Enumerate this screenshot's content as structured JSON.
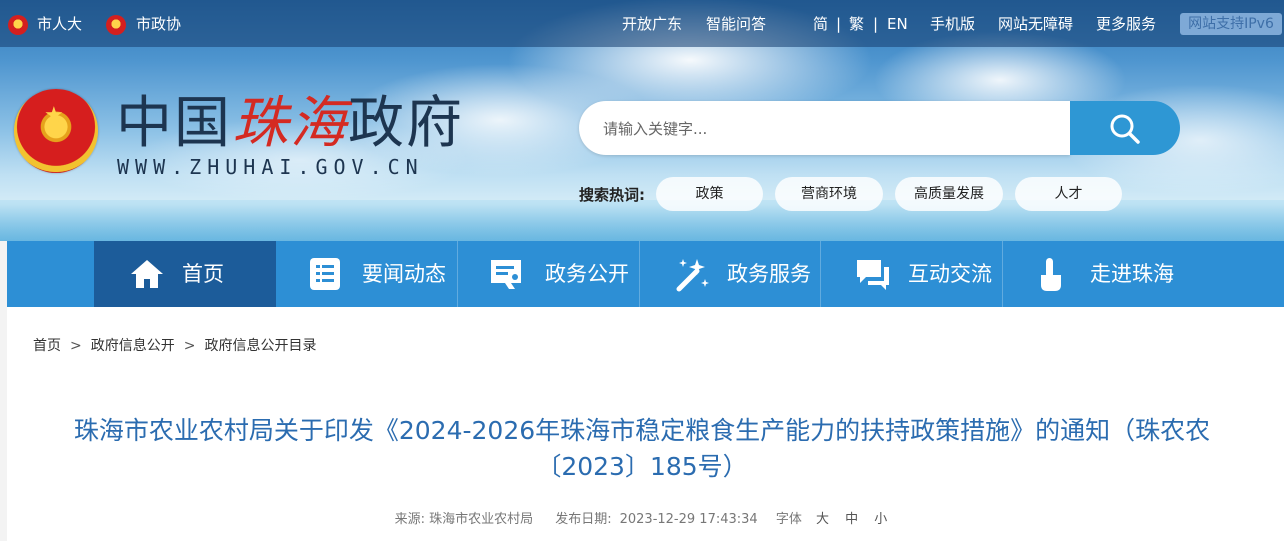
{
  "topbar": {
    "left_links": [
      {
        "label": "市人大"
      },
      {
        "label": "市政协"
      }
    ],
    "right_links": [
      {
        "label": "开放广东"
      },
      {
        "label": "智能问答"
      },
      {
        "label": "简"
      },
      {
        "label": "繁"
      },
      {
        "label": "EN"
      },
      {
        "label": "手机版"
      },
      {
        "label": "网站无障碍"
      },
      {
        "label": "更多服务"
      }
    ],
    "separator": "|",
    "ipv6_badge": "网站支持IPv6"
  },
  "logo": {
    "title_part1": "中国",
    "title_part2": "珠海",
    "title_part3": "政府",
    "url": "WWW.ZHUHAI.GOV.CN"
  },
  "search": {
    "placeholder": "请输入关键字...",
    "hot_label": "搜索热词:",
    "hot_words": [
      "政策",
      "营商环境",
      "高质量发展",
      "人才"
    ]
  },
  "nav": {
    "items": [
      {
        "label": "首页",
        "icon": "home-icon",
        "active": true
      },
      {
        "label": "要闻动态",
        "icon": "news-list-icon"
      },
      {
        "label": "政务公开",
        "icon": "document-icon"
      },
      {
        "label": "政务服务",
        "icon": "magic-wand-icon"
      },
      {
        "label": "互动交流",
        "icon": "chat-icon"
      },
      {
        "label": "走进珠海",
        "icon": "pointer-hand-icon"
      }
    ]
  },
  "breadcrumb": {
    "items": [
      "首页",
      "政府信息公开",
      "政府信息公开目录"
    ],
    "separator": ">"
  },
  "article": {
    "title": "珠海市农业农村局关于印发《2024-2026年珠海市稳定粮食生产能力的扶持政策措施》的通知（珠农农〔2023〕185号）",
    "source_label": "来源:",
    "source_value": "珠海市农业农村局",
    "date_label": "发布日期:",
    "date_value": "2023-12-29 17:43:34",
    "font_label": "字体",
    "font_sizes": [
      "大",
      "中",
      "小"
    ]
  },
  "colors": {
    "nav_bg": "#2d8fd5",
    "nav_active": "#1c5c9a",
    "title": "#2b6cb0",
    "search_button": "#2e97d4"
  }
}
